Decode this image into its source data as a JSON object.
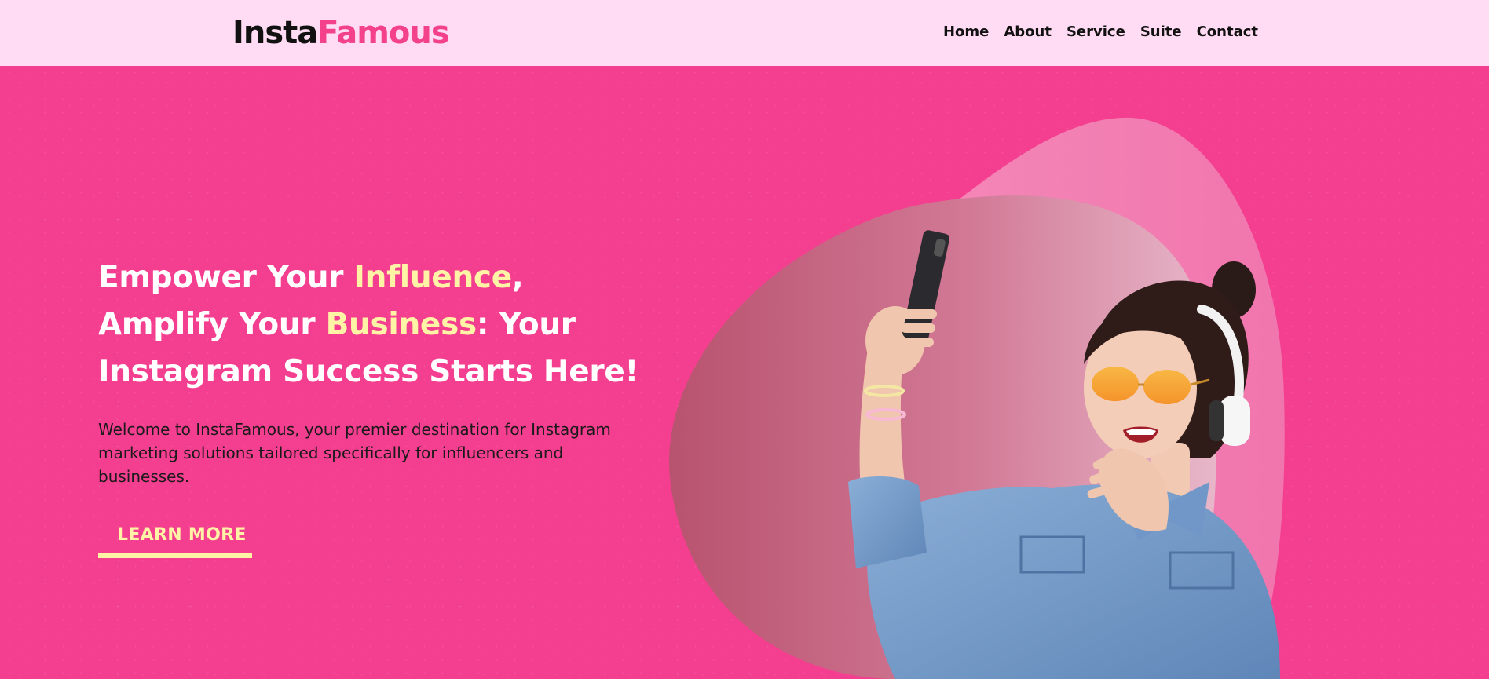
{
  "header": {
    "logo_part1": "Insta",
    "logo_part2": "Famous",
    "nav": [
      "Home",
      "About",
      "Service",
      "Suite",
      "Contact"
    ]
  },
  "hero": {
    "headline_1": "Empower Your ",
    "headline_hl1": "Influence",
    "headline_2": ", Amplify Your ",
    "headline_hl2": "Business",
    "headline_3": ": Your Instagram Success Starts Here!",
    "intro": "Welcome to InstaFamous, your premier destination for Instagram marketing solutions tailored specifically for influencers and businesses.",
    "cta_label": "LEARN MORE"
  },
  "colors": {
    "header_bg": "#ffdcf3",
    "hero_bg": "#f43e8f",
    "accent_yellow": "#fff3a6",
    "brand_pink": "#f4418c"
  },
  "icons": [
    "smartphone-icon",
    "headphones-icon"
  ]
}
